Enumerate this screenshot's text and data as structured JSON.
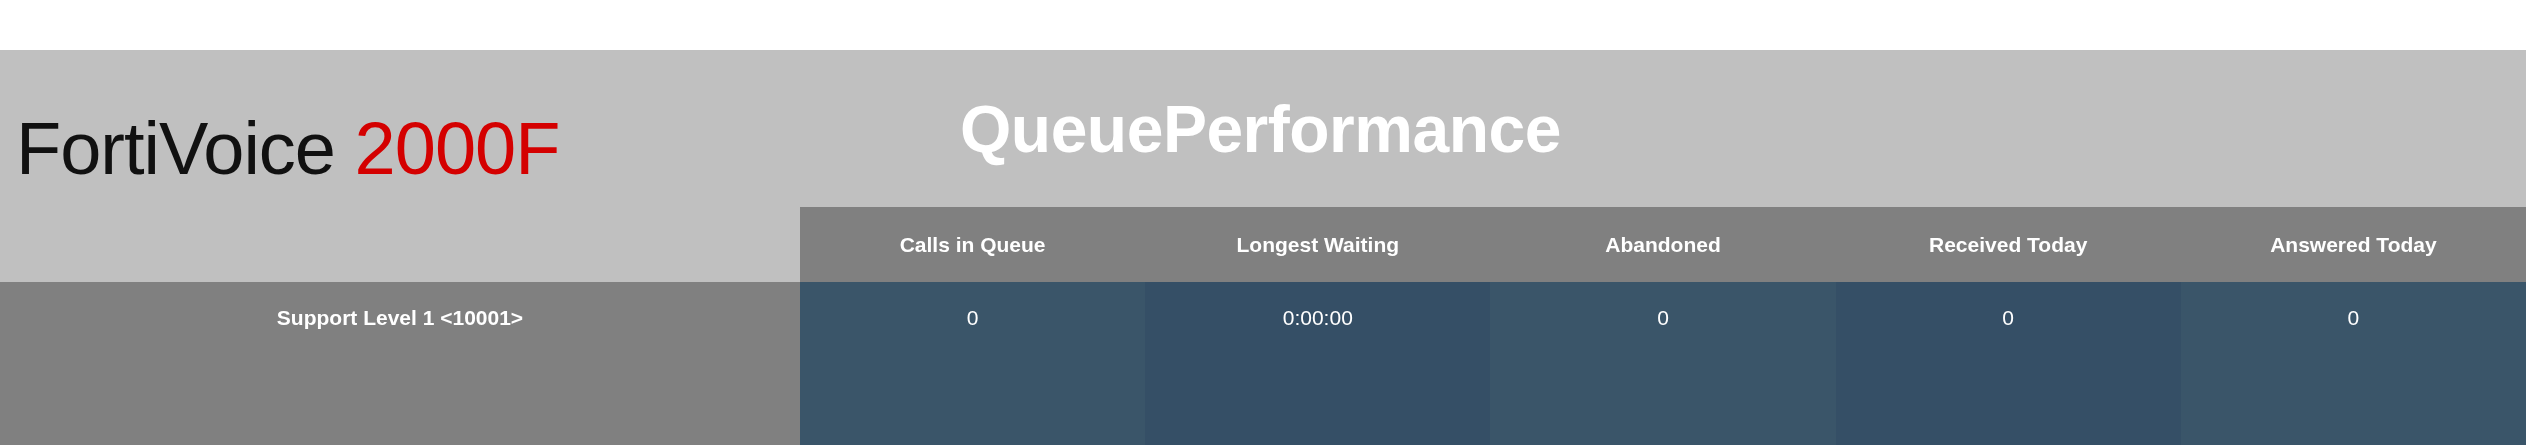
{
  "logo": {
    "brand": "FortiVoice",
    "model": "2000F"
  },
  "title": "QueuePerformance",
  "table": {
    "columns": [
      "Calls in Queue",
      "Longest Waiting",
      "Abandoned",
      "Received Today",
      "Answered Today"
    ],
    "rows": [
      {
        "queue": "Support Level 1 <10001>",
        "cells": [
          "0",
          "0:00:00",
          "0",
          "0",
          "0"
        ]
      }
    ]
  }
}
